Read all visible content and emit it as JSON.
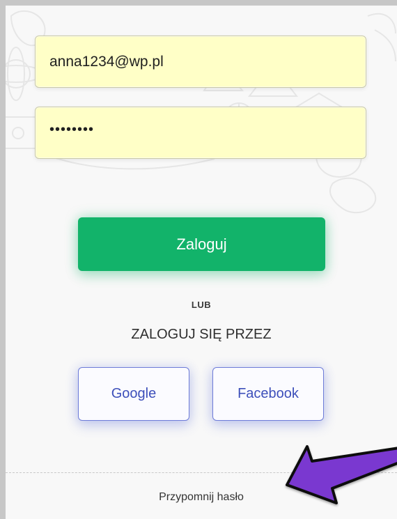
{
  "login_form": {
    "email_value": "anna1234@wp.pl",
    "password_value": "••••••••",
    "login_button_label": "Zaloguj",
    "or_label": "LUB",
    "login_via_label": "ZALOGUJ SIĘ PRZEZ",
    "social_buttons": [
      {
        "label": "Google"
      },
      {
        "label": "Facebook"
      }
    ],
    "remind_password_label": "Przypomnij hasło"
  },
  "annotation": {
    "icon": "arrow-icon",
    "color": "#7a37d0"
  },
  "colors": {
    "input_background": "#ffffc7",
    "login_button": "#12b36a",
    "social_border": "#6d7bd8",
    "social_text": "#3d4fba"
  }
}
